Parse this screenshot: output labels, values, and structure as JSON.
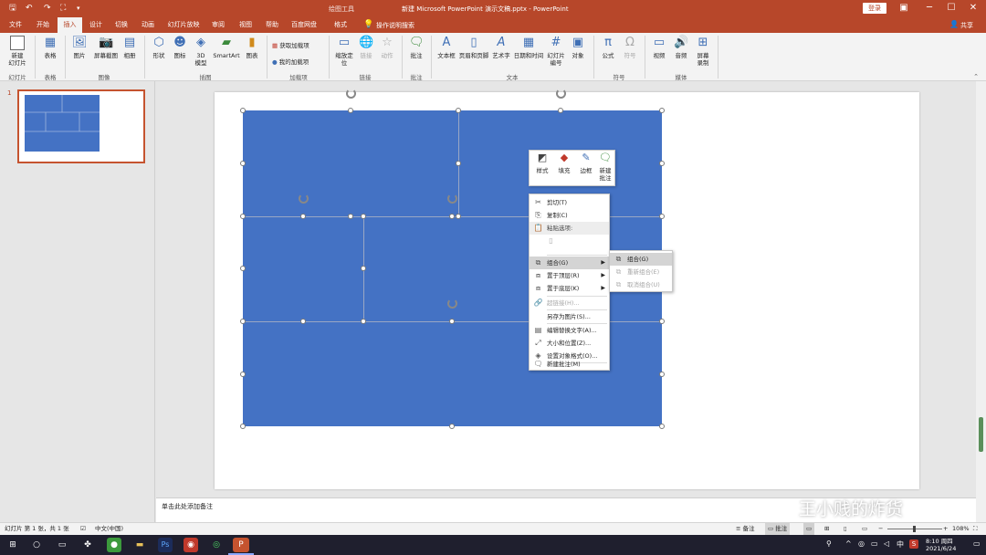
{
  "titlebar": {
    "title": "新建 Microsoft PowerPoint 演示文稿.pptx  -  PowerPoint",
    "context_label": "绘图工具",
    "login": "登录",
    "save_icon": "save-icon",
    "undo_icon": "undo-icon",
    "redo_icon": "redo-icon"
  },
  "tabs": [
    "文件",
    "开始",
    "插入",
    "设计",
    "切换",
    "动画",
    "幻灯片放映",
    "审阅",
    "视图",
    "帮助",
    "百度网盘",
    "格式"
  ],
  "active_tab": "插入",
  "tell_me": "操作说明搜索",
  "share": "共享",
  "ribbon": {
    "buttons": [
      "新建\n幻灯片",
      "表格",
      "图片",
      "屏幕截图",
      "相册",
      "形状",
      "图标",
      "3D\n模型",
      "SmartArt",
      "图表",
      "获取加载项",
      "我的加载项",
      "缩放定\n位",
      "链接",
      "动作",
      "批注",
      "文本框",
      "页眉和页脚",
      "艺术字",
      "日期和时间",
      "幻灯片\n编号",
      "对象",
      "公式",
      "符号",
      "视频",
      "音频",
      "屏幕\n录制"
    ],
    "groups": [
      "幻灯片",
      "表格",
      "图像",
      "插图",
      "加载项",
      "链接",
      "批注",
      "文本",
      "符号",
      "媒体"
    ]
  },
  "thumbnail": {
    "number": "1"
  },
  "mini_toolbar": [
    "样式",
    "填充",
    "边框",
    "新建\n批注"
  ],
  "context_menu": {
    "items": [
      "剪切(T)",
      "复制(C)",
      "粘贴选项:",
      "组合(G)",
      "置于顶层(R)",
      "置于底层(K)",
      "超链接(H)...",
      "另存为图片(S)...",
      "编辑替换文字(A)...",
      "大小和位置(Z)...",
      "设置对象格式(O)...",
      "新建批注(M)"
    ],
    "highlighted": "组合(G)"
  },
  "submenu": {
    "items": [
      "组合(G)",
      "重新组合(E)",
      "取消组合(U)"
    ]
  },
  "notes_placeholder": "单击此处添加备注",
  "status": {
    "slide_info": "幻灯片 第 1 张，共 1 张",
    "language": "中文(中国)",
    "notes": "备注",
    "comments": "批注",
    "zoom": "108%"
  },
  "taskbar": {
    "time": "8:10 周四",
    "date": "2021/6/24",
    "ime": "中"
  },
  "watermark": "王小贱的炸货",
  "colors": {
    "accent": "#b7472a",
    "shape_fill": "#4472c4"
  }
}
